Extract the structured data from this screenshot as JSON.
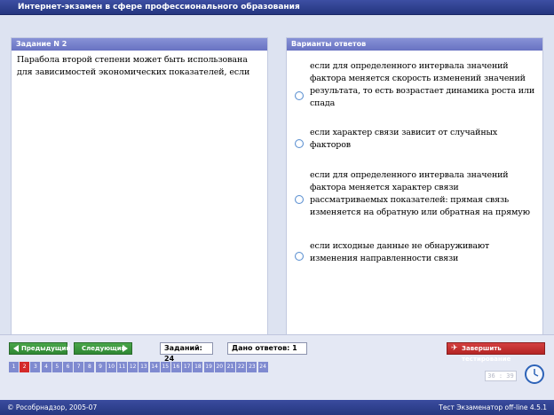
{
  "window_title": "Интернет-экзамен в сфере профессионального образования",
  "question": {
    "header": "Задание N 2",
    "text": "Парабола второй степени может быть использована для зависимостей экономических показателей, если"
  },
  "answers": {
    "header": "Варианты ответов",
    "options": [
      {
        "label": "если для определенного интервала значений фактора меняется скорость  изменений значений результата, то есть возрастает динамика роста или спада",
        "selected": false
      },
      {
        "label": "если характер связи зависит от случайных факторов",
        "selected": false
      },
      {
        "label": "если для определенного интервала значений фактора меняется характер связи рассматриваемых показателей: прямая связь изменяется на обратную или обратная на прямую",
        "selected": false
      },
      {
        "label": "если исходные данные не обнаруживают изменения направленности связи",
        "selected": false
      }
    ]
  },
  "navigation": {
    "prev_label": "Предыдущий",
    "next_label": "Следующий",
    "tasks_count": "Заданий: 24",
    "answers_given": "Дано ответов: 1",
    "finish_label": "Завершить тестирование",
    "current_question": 2,
    "question_numbers": [
      "1",
      "2",
      "3",
      "4",
      "5",
      "6",
      "7",
      "8",
      "9",
      "10",
      "11",
      "12",
      "13",
      "14",
      "15",
      "16",
      "17",
      "18",
      "19",
      "20",
      "21",
      "22",
      "23",
      "24"
    ]
  },
  "timer": "36 : 39",
  "footer": {
    "copyright": "© Рособрнадзор, 2005-07",
    "version": "Тест Экзаменатор off-line 4.5.1"
  },
  "colors": {
    "title_bar": "#2c3d8c",
    "panel_header": "#7a84cf",
    "nav_button": "#3a9a3e",
    "finish_button": "#c63232",
    "question_cell": "#7f8ad0",
    "current_question": "#d42a2a"
  }
}
